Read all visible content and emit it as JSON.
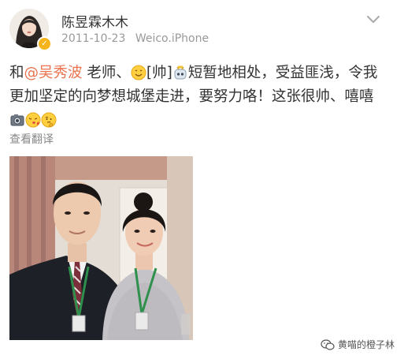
{
  "post": {
    "username": "陈昱霖木木",
    "date": "2011-10-23",
    "source": "Weico.iPhone",
    "text": {
      "part1": "和",
      "mention": "@吴秀波",
      "part2": " 老师、",
      "bracket": "[帅]",
      "part3": "短暂地相处，受益匪浅，令我更加坚定的向梦想城堡走进，要努力咯！这张很帅、嘻嘻"
    },
    "translate_label": "查看翻译"
  },
  "watermark": {
    "text": "黄喵的橙子林"
  },
  "icons": {
    "verified": "verified-badge-icon",
    "menu": "chevron-down-icon",
    "emojis": [
      "smile-emoji-icon",
      "robot-emoji-icon",
      "camera-emoji-icon",
      "kiss-emoji-icon",
      "thinking-emoji-icon"
    ],
    "watermark": "wechat-icon"
  },
  "colors": {
    "mention": "#eb7350",
    "meta": "#999999",
    "verified": "#f6b41b"
  }
}
